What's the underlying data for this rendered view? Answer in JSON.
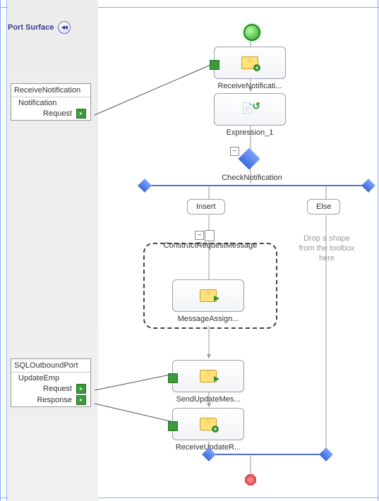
{
  "header": {
    "port_surface": "Port Surface"
  },
  "ports": {
    "receiveNotification": {
      "title": "ReceiveNotification",
      "operation": "Notification",
      "messages": [
        {
          "label": "Request"
        }
      ]
    },
    "sqlOutbound": {
      "title": "SQLOutboundPort",
      "operation": "UpdateEmp",
      "messages": [
        {
          "label": "Request"
        },
        {
          "label": "Response"
        }
      ]
    }
  },
  "shapes": {
    "receiveNotification": "ReceiveNotificati...",
    "expression": "Expression_1",
    "decision": "CheckNotification",
    "branchInsert": "Insert",
    "branchElse": "Else",
    "construct": "ConstructRequestMessage",
    "messageAssign": "MessageAssign...",
    "sendUpdate": "SendUpdateMes...",
    "receiveUpdate": "ReceiveUpdateR...",
    "elseHint": "Drop a shape from the toolbox here"
  },
  "colors": {
    "line": "#9a9a9a",
    "blueLine": "#4f70d6",
    "darkLine": "#777"
  }
}
